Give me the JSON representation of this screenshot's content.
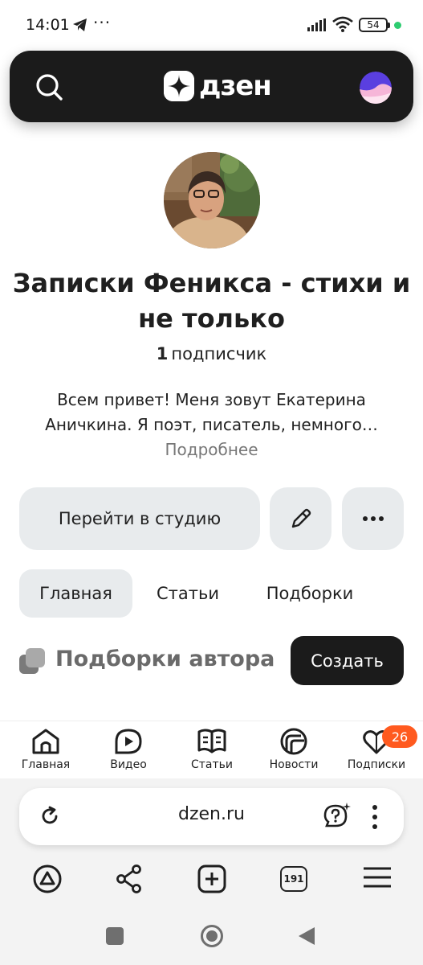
{
  "status_bar": {
    "time": "14:01",
    "more": "···",
    "battery": "54",
    "icons": [
      "telegram-icon",
      "signal-icon",
      "wifi-icon",
      "battery-icon"
    ]
  },
  "header": {
    "logo_text": "дзен",
    "icons": [
      "search-icon",
      "dzen-logo-icon",
      "profile-avatar"
    ]
  },
  "channel": {
    "title": "Записки Феникса - стихи и не только",
    "subscribers_count": "1",
    "subscribers_label": "подписчик",
    "description": "Всем привет! Меня зовут Екатерина Аничкина. Я поэт, писатель, немного…",
    "more_link": "Подробнее"
  },
  "actions": {
    "studio_label": "Перейти в студию",
    "icons": [
      "pencil-icon",
      "more-dots-icon"
    ]
  },
  "tabs": [
    {
      "label": "Главная",
      "active": true
    },
    {
      "label": "Статьи",
      "active": false
    },
    {
      "label": "Подборки",
      "active": false
    }
  ],
  "collections": {
    "title": "Подборки автора",
    "create_label": "Создать"
  },
  "bottom_nav": {
    "items": [
      {
        "label": "Главная",
        "icon": "home-icon"
      },
      {
        "label": "Видео",
        "icon": "video-icon"
      },
      {
        "label": "Статьи",
        "icon": "articles-icon"
      },
      {
        "label": "Новости",
        "icon": "news-icon"
      },
      {
        "label": "Подписки",
        "icon": "subscriptions-icon"
      }
    ],
    "subs_badge": "26"
  },
  "browser": {
    "url": "dzen.ru",
    "tabs_count": "191",
    "icons": [
      "reload-icon",
      "help-icon",
      "menu-dots-icon",
      "alice-icon",
      "share-icon",
      "new-tab-icon",
      "hamburger-icon"
    ]
  },
  "colors": {
    "header_bg": "#1b1b1b",
    "button_grey": "#e8ebed",
    "badge": "#ff5a1f",
    "status_dot": "#2ecc71"
  }
}
